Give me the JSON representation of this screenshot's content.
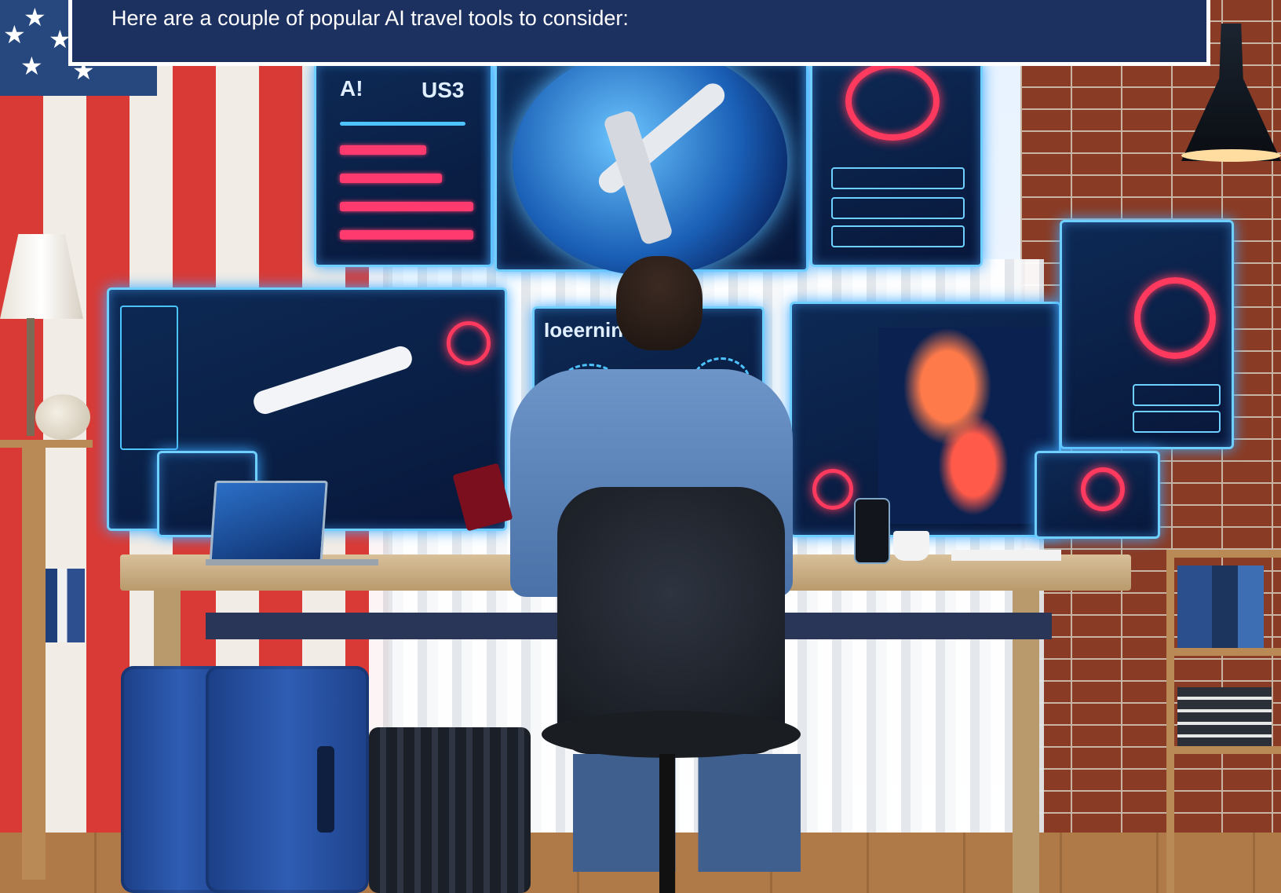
{
  "caption": {
    "text": "Here are a couple of popular AI travel tools to consider:"
  },
  "screens": {
    "top_left_header_1": "A!",
    "top_left_header_2": "US3",
    "center_panel_title": "Ioeernin"
  },
  "colors": {
    "caption_bg": "#1c3160",
    "caption_text": "#ffffff",
    "hologram_glow": "#6fd0ff",
    "hologram_accent": "#ff3a6e"
  }
}
